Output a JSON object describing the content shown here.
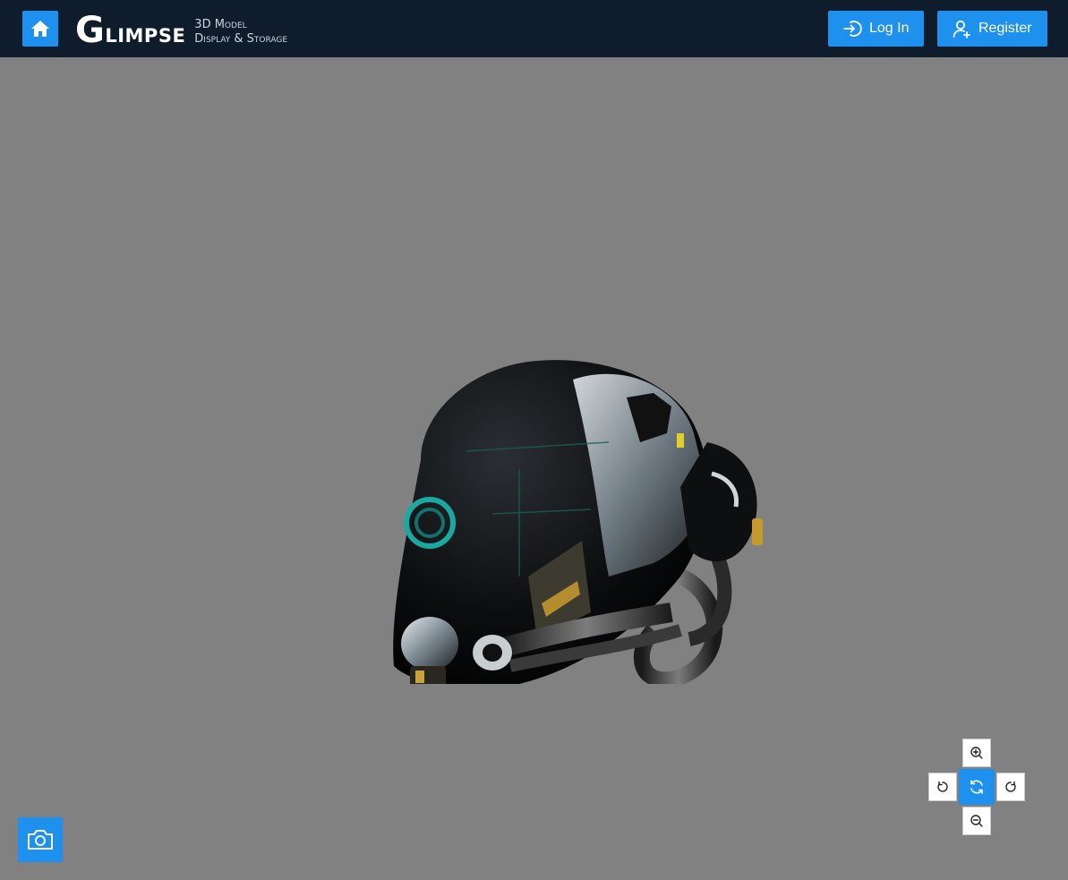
{
  "navbar": {
    "brand_first": "G",
    "brand_rest": "limpse",
    "tagline_line1": "3D Model",
    "tagline_line2": "Display & Storage",
    "login_label": "Log In",
    "register_label": "Register",
    "icons": {
      "home": "home-icon",
      "login": "login-icon",
      "register": "user-plus-icon"
    }
  },
  "viewer": {
    "model_subject": "sci-fi helmet",
    "controls": [
      "zoom-in",
      "rotate-left",
      "reset-view",
      "rotate-right",
      "zoom-out"
    ]
  },
  "colors": {
    "accent": "#1e90ee",
    "navbar_bg": "#0f1c2b",
    "viewer_bg": "#818181"
  }
}
